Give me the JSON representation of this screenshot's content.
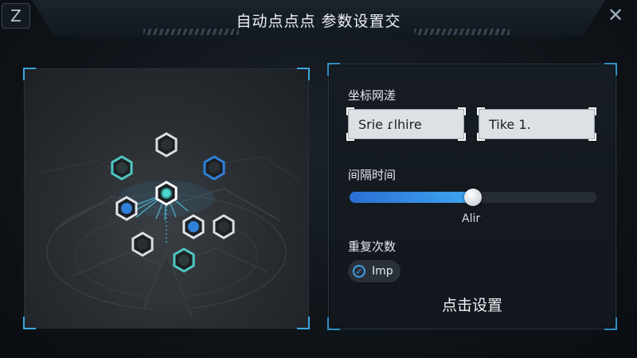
{
  "header": {
    "title": "自动点点点 参数设置交",
    "left_button_glyph": "Z",
    "close_glyph": "✕"
  },
  "map": {
    "nodes": [
      {
        "style": "dark"
      },
      {
        "style": "teal"
      },
      {
        "style": "blue-ring"
      },
      {
        "style": "teal-center"
      },
      {
        "style": "blue-dot"
      },
      {
        "style": "blue-dot"
      },
      {
        "style": "dark"
      },
      {
        "style": "dark"
      },
      {
        "style": "teal"
      }
    ]
  },
  "settings": {
    "coord_label": "坐标网溠",
    "coord_x_value": "Srie ɾlhire",
    "coord_y_value": "Tike 1.",
    "interval_label": "间隔时间",
    "interval_value_label": "Alir",
    "interval_fraction": 0.5,
    "repeat_label": "重复次数",
    "repeat_chip_label": "Imp",
    "repeat_checked": true,
    "action_button_label": "点击设置"
  },
  "colors": {
    "accent": "#3aa8e0",
    "teal": "#4fc7c2",
    "blue": "#2f7fd6",
    "background": "#0d1116"
  },
  "icons": {
    "left_button": "z-icon",
    "close": "close-icon",
    "check": "check-icon"
  }
}
